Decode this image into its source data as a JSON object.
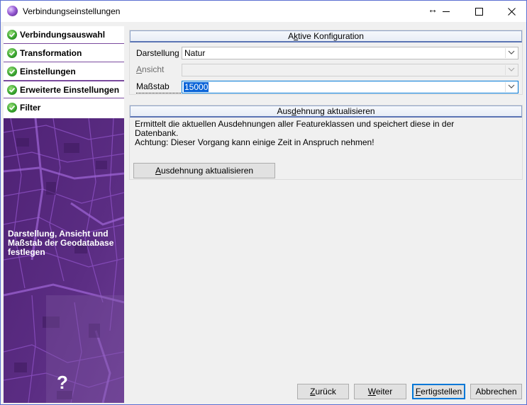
{
  "window": {
    "title": "Verbindungseinstellungen",
    "icons": {
      "app": "globe-icon",
      "resize": "resize-arrows-icon",
      "minimize": "minimize-icon",
      "maximize": "maximize-icon",
      "close": "close-icon"
    }
  },
  "sidebar": {
    "steps": [
      {
        "label": "Verbindungsauswahl",
        "icon": "check-icon"
      },
      {
        "label": "Transformation",
        "icon": "check-icon"
      },
      {
        "label": "Einstellungen",
        "icon": "check-icon"
      },
      {
        "label": "Erweiterte Einstellungen",
        "icon": "check-icon"
      },
      {
        "label": "Filter",
        "icon": "check-icon"
      }
    ],
    "active_step": "Erweiterte Einstellungen",
    "description": "Darstellung, Ansicht und Maßstab der Geodatabase festlegen",
    "help": "?"
  },
  "config": {
    "header_pre": "A",
    "header_ul": "k",
    "header_post": "tive Konfiguration",
    "darstellung": {
      "label": "Darstellung",
      "value": "Natur"
    },
    "ansicht": {
      "label_ul": "A",
      "label_rest": "nsicht",
      "value": ""
    },
    "massstab": {
      "label": "Maßstab",
      "value": "15000"
    }
  },
  "extent": {
    "header_pre": "Aus",
    "header_ul": "d",
    "header_post": "ehnung aktualisieren",
    "description_line1": "Ermittelt die aktuellen Ausdehnungen aller Featureklassen und speichert diese in der",
    "description_line2": "Datenbank.",
    "description_line3": "Achtung: Dieser Vorgang kann einige Zeit in Anspruch nehmen!",
    "button_ul": "A",
    "button_rest": "usdehnung aktualisieren"
  },
  "footer": {
    "back_ul": "Z",
    "back_rest": "urück",
    "next_ul": "W",
    "next_rest": "eiter",
    "finish_ul": "F",
    "finish_rest": "ertigstellen",
    "cancel": "Abbrechen"
  },
  "colors": {
    "sidebar_bg": "#58297f",
    "accent": "#0078d7",
    "check": "#34a02b",
    "selection": "#0a64d8"
  }
}
